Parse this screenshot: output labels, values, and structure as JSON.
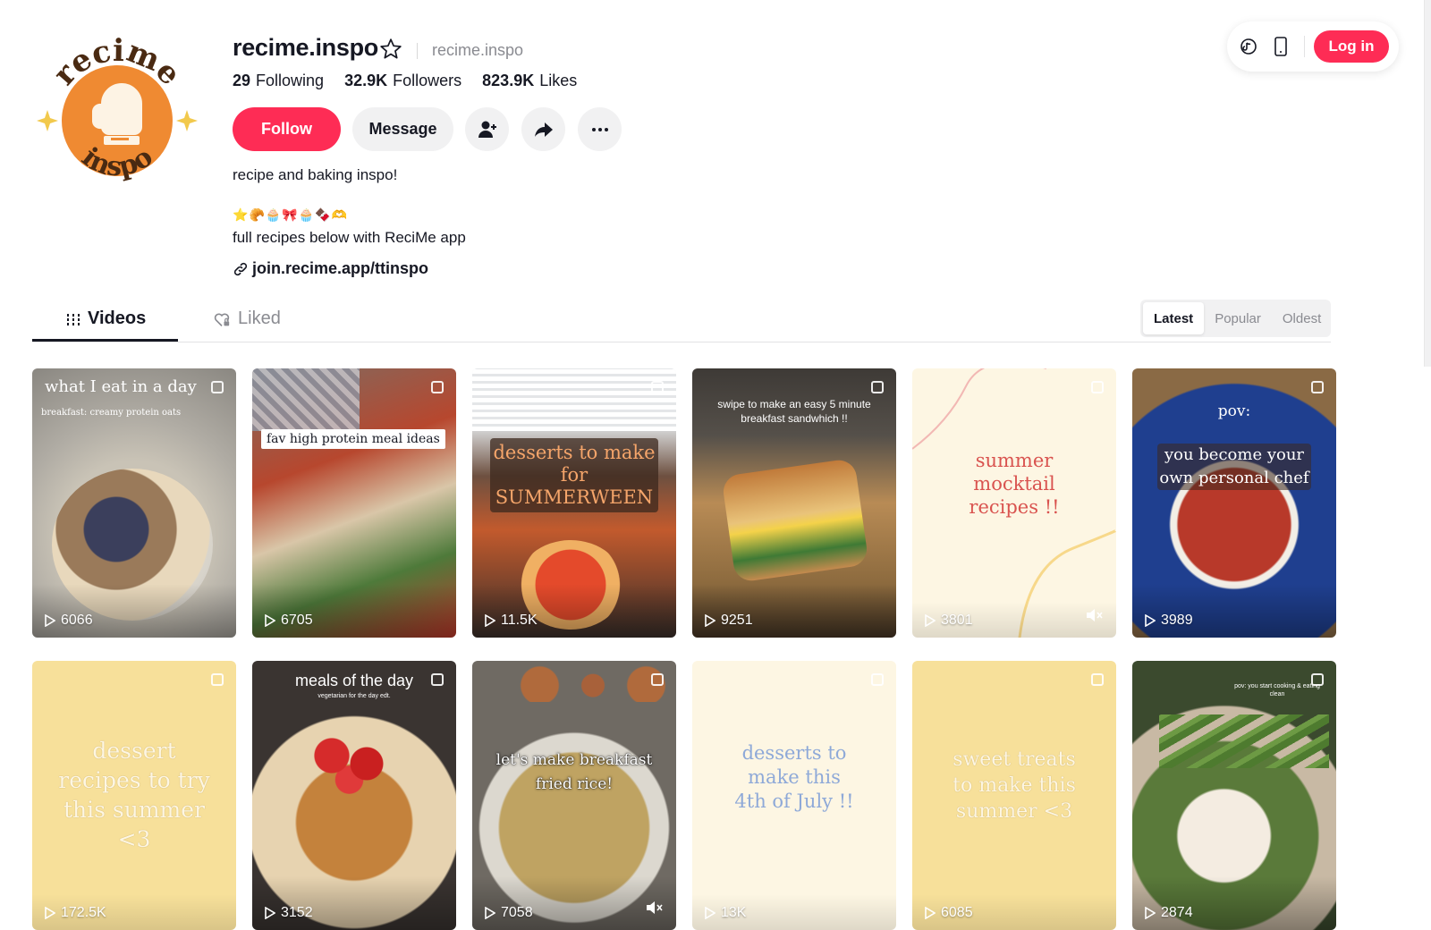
{
  "topbar": {
    "login_label": "Log in",
    "icons": [
      "tiktok-coin-icon",
      "mobile-phone-icon"
    ]
  },
  "profile": {
    "username": "recime.inspo",
    "handle": "recime.inspo",
    "stats": {
      "following_count": "29",
      "following_label": "Following",
      "followers_count": "32.9K",
      "followers_label": "Followers",
      "likes_count": "823.9K",
      "likes_label": "Likes"
    },
    "follow_label": "Follow",
    "message_label": "Message",
    "bio_line1": "recipe and baking inspo!",
    "bio_emojis": [
      "⭐",
      "🥐",
      "🧁",
      "🎀",
      "🧁",
      "🍫",
      "🫶"
    ],
    "bio_line2": "full recipes below with ReciMe app",
    "link": "join.recime.app/ttinspo",
    "avatar_text_top": "recime",
    "avatar_text_bottom": "inspo"
  },
  "tabs": [
    {
      "label": "Videos",
      "active": true
    },
    {
      "label": "Liked",
      "active": false
    }
  ],
  "sort": {
    "options": [
      "Latest",
      "Popular",
      "Oldest"
    ],
    "selected": "Latest"
  },
  "videos": [
    {
      "views": "6066",
      "title": "what I eat in a day",
      "subtitle": "breakfast: creamy protein oats"
    },
    {
      "views": "6705",
      "title": "fav high protein meal ideas"
    },
    {
      "views": "11.5K",
      "title": "desserts to make for SUMMERWEEN"
    },
    {
      "views": "9251",
      "title": "swipe to make an easy 5 minute breakfast sandwhich !!"
    },
    {
      "views": "3801",
      "title": "summer mocktail recipes !!"
    },
    {
      "views": "3989",
      "title": "pov:",
      "subtitle": "you become your own personal chef"
    },
    {
      "views": "172.5K",
      "title": "dessert recipes to try this summer <3"
    },
    {
      "views": "3152",
      "title": "meals of the day",
      "subtitle": "vegetarian for the day edt."
    },
    {
      "views": "7058",
      "title": "let's make breakfast fried rice!"
    },
    {
      "views": "13K",
      "title": "desserts to make this 4th of July !!"
    },
    {
      "views": "6085",
      "title": "sweet treats to make this summer <3"
    },
    {
      "views": "2874",
      "title": "pov: you start cooking & eating clean"
    }
  ],
  "colors": {
    "brand_red": "#fe2c55",
    "avatar_orange": "#ef8a32",
    "pastel_yellow": "#f7e09a",
    "cream": "#fdf6e3"
  }
}
